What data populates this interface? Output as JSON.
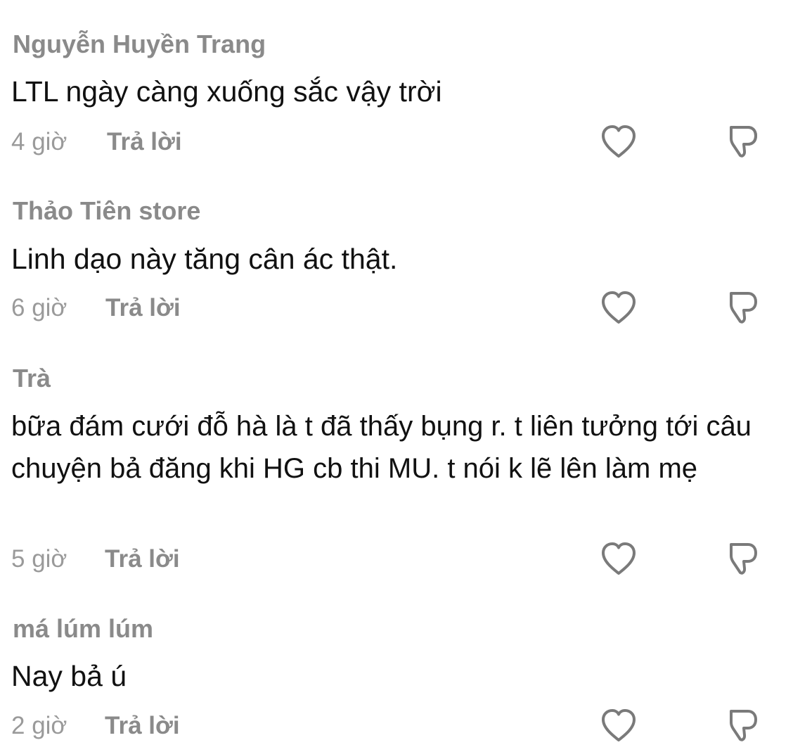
{
  "comments": [
    {
      "author": "Nguyễn Huyền Trang",
      "text": "LTL ngày càng xuống sắc vậy trời",
      "time": "4 giờ",
      "reply_label": "Trả lời"
    },
    {
      "author": "Thảo Tiên store",
      "text": "Linh dạo này tăng cân ác thật.",
      "time": "6 giờ",
      "reply_label": "Trả lời"
    },
    {
      "author": "Trà",
      "text": "bữa đám cưới đỗ hà là t đã thấy bụng r. t liên tưởng tới câu chuyện bả đăng khi HG cb thi MU. t nói k lẽ lên làm mẹ",
      "time": "5 giờ",
      "reply_label": "Trả lời"
    },
    {
      "author": "má lúm lúm",
      "text": "Nay bả ú",
      "time": "2 giờ",
      "reply_label": "Trả lời"
    }
  ],
  "icons": {
    "like": "heart-icon",
    "dislike": "thumbs-down-icon"
  },
  "colors": {
    "author": "#8a8a8a",
    "text": "#111111",
    "time": "#9a9a9a",
    "icon": "#7a7a7a"
  }
}
